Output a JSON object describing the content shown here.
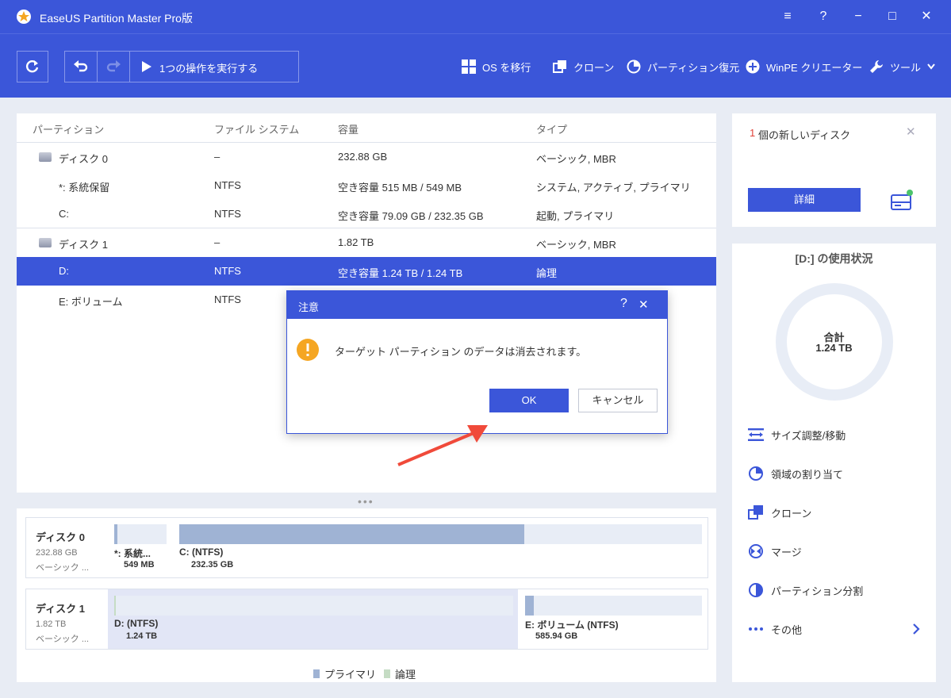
{
  "app": {
    "title": "EaseUS Partition Master Pro版"
  },
  "window_controls": {
    "menu": "≡",
    "help": "?",
    "minimize": "−",
    "maximize": "□",
    "close": "✕"
  },
  "toolbar": {
    "refresh_icon": "refresh-icon",
    "execute_label": "1つの操作を実行する",
    "items": [
      {
        "label": "OS を移行",
        "icon": "windows-icon"
      },
      {
        "label": "クローン",
        "icon": "clone-icon"
      },
      {
        "label": "パーティション復元",
        "icon": "pie-icon"
      },
      {
        "label": "WinPE クリエーター",
        "icon": "plus-circle-icon"
      },
      {
        "label": "ツール",
        "icon": "wrench-icon"
      }
    ]
  },
  "partition_table": {
    "headers": [
      "パーティション",
      "ファイル システム",
      "容量",
      "タイプ"
    ],
    "rows": [
      {
        "name": "ディスク 0",
        "fs": "–",
        "capacity": "232.88 GB",
        "type": "ベーシック, MBR",
        "is_disk": true
      },
      {
        "name": "*: 系統保留",
        "fs": "NTFS",
        "capacity": "空き容量 515 MB / 549 MB",
        "type": "システム, アクティブ, プライマリ"
      },
      {
        "name": "C:",
        "fs": "NTFS",
        "capacity": "空き容量 79.09 GB / 232.35 GB",
        "type": "起動, プライマリ"
      },
      {
        "name": "ディスク 1",
        "fs": "–",
        "capacity": "1.82 TB",
        "type": "ベーシック, MBR",
        "is_disk": true
      },
      {
        "name": "D:",
        "fs": "NTFS",
        "capacity": "空き容量 1.24 TB / 1.24 TB",
        "type": "論理",
        "selected": true
      },
      {
        "name": "E: ボリューム",
        "fs": "NTFS",
        "capacity": "",
        "type": ""
      }
    ]
  },
  "disk_map": {
    "disks": [
      {
        "name": "ディスク 0",
        "size": "232.88 GB",
        "type": "ベーシック ...",
        "partitions": [
          {
            "label": "*: 系統...",
            "size": "549 MB",
            "used_fraction": 0.06
          },
          {
            "label": "C: (NTFS)",
            "size": "232.35 GB",
            "used_fraction": 0.66
          }
        ]
      },
      {
        "name": "ディスク 1",
        "size": "1.82 TB",
        "type": "ベーシック ...",
        "partitions": [
          {
            "label": "D: (NTFS)",
            "size": "1.24 TB",
            "used_fraction": 0.0
          },
          {
            "label": "E: ボリューム (NTFS)",
            "size": "585.94 GB",
            "used_fraction": 0.05
          }
        ]
      }
    ],
    "legend": [
      {
        "label": "プライマリ",
        "color": "#9fb3d4"
      },
      {
        "label": "論理",
        "color": "#c5dcc4"
      }
    ]
  },
  "new_disk_panel": {
    "count": "1",
    "text": "個の新しいディスク",
    "details_button": "詳細"
  },
  "usage_panel": {
    "title": "[D:] の使用状況",
    "total_label": "合計",
    "total_value": "1.24 TB",
    "actions": [
      {
        "label": "サイズ調整/移動",
        "icon": "resize-icon"
      },
      {
        "label": "領域の割り当て",
        "icon": "allocate-icon"
      },
      {
        "label": "クローン",
        "icon": "clone-icon"
      },
      {
        "label": "マージ",
        "icon": "merge-icon"
      },
      {
        "label": "パーティション分割",
        "icon": "split-icon"
      },
      {
        "label": "その他",
        "icon": "more-icon"
      }
    ]
  },
  "dialog": {
    "title": "注意",
    "message": "ターゲット パーティション のデータは消去されます。",
    "ok_label": "OK",
    "cancel_label": "キャンセル",
    "help": "?",
    "close": "✕"
  },
  "colors": {
    "accent": "#3b56d9",
    "warning": "#f5a623",
    "arrow": "#f04a3a"
  }
}
